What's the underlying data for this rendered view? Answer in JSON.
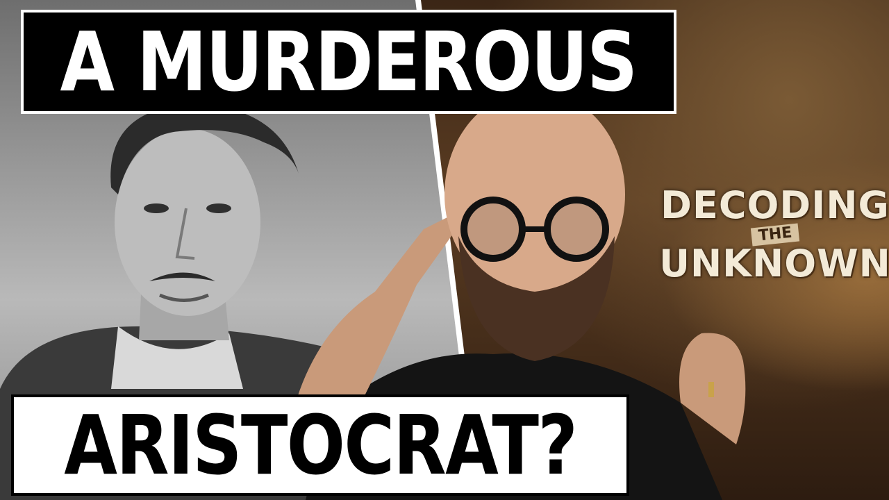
{
  "headline": {
    "top": "A MURDEROUS",
    "bottom": "ARISTOCRAT?"
  },
  "logo": {
    "line1": "DECODING",
    "line2": "THE",
    "line3": "UNKNOWN"
  },
  "colors": {
    "headline_text": "#ffffff",
    "headline_box": "#000000",
    "logo_text": "#f3ead7"
  }
}
